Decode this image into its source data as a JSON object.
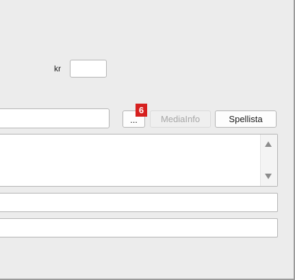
{
  "price": {
    "currency_label": "kr",
    "value": ""
  },
  "path": {
    "value": ""
  },
  "buttons": {
    "browse_label": "...",
    "mediainfo_label": "MediaInfo",
    "mediainfo_enabled": false,
    "spellista_label": "Spellista"
  },
  "badge": {
    "text": "6",
    "color": "#d6201f"
  },
  "description": {
    "value": ""
  },
  "fields": {
    "field1_value": "",
    "field2_value": ""
  }
}
